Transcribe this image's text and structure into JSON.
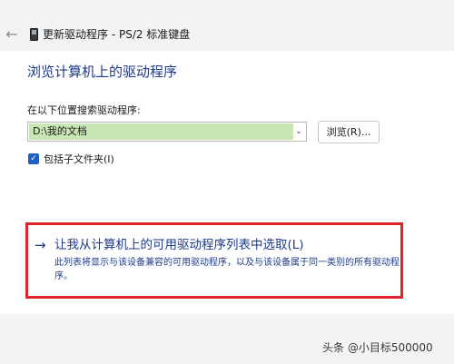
{
  "window": {
    "title": "更新驱动程序 - PS/2 标准键盘"
  },
  "page": {
    "heading": "浏览计算机上的驱动程序"
  },
  "search": {
    "label": "在以下位置搜索驱动程序:",
    "value": "D:\\我的文档",
    "browse_label": "浏览(R)..."
  },
  "include_subfolders": {
    "label": "包括子文件夹(I)",
    "checked": true
  },
  "pick_option": {
    "arrow": "→",
    "title": "让我从计算机上的可用驱动程序列表中选取(L)",
    "description": "此列表将显示与该设备兼容的可用驱动程序，以及与该设备属于同一类别的所有驱动程序。"
  },
  "watermark": {
    "text": "头条 @小目标500000"
  },
  "icons": {
    "back": "arrow-left",
    "device": "device-generic",
    "checkbox": "checkmark",
    "combo": "chevron-down"
  },
  "colors": {
    "accent": "#1e5fbf",
    "link_text": "#1e3a8a",
    "highlight_border": "#e0242b",
    "input_highlight": "#c9e6b5"
  }
}
